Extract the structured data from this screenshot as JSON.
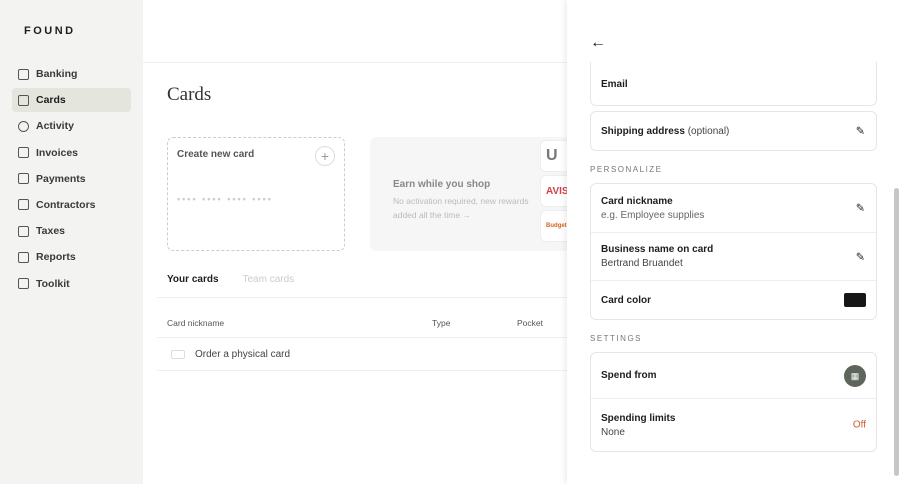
{
  "sidebar": {
    "logo": "FOUND",
    "items": [
      {
        "label": "Banking"
      },
      {
        "label": "Cards"
      },
      {
        "label": "Activity"
      },
      {
        "label": "Invoices"
      },
      {
        "label": "Payments"
      },
      {
        "label": "Contractors"
      },
      {
        "label": "Taxes"
      },
      {
        "label": "Reports"
      },
      {
        "label": "Toolkit"
      }
    ]
  },
  "main": {
    "title": "Cards",
    "create_label": "Create new card",
    "card_dots": "•••• •••• •••• ••••",
    "earn_title": "Earn while you shop",
    "earn_sub": "No activation required, new rewards added all the time →",
    "partners": [
      "U",
      "AVIS",
      "Budget"
    ],
    "tabs": [
      "Your cards",
      "Team cards"
    ],
    "columns": [
      "Card nickname",
      "Type",
      "Pocket"
    ],
    "row_label": "Order a physical card"
  },
  "drawer": {
    "email_label": "Email",
    "shipping_label": "Shipping address",
    "shipping_optional": "(optional)",
    "personalize_label": "PERSONALIZE",
    "nickname_label": "Card nickname",
    "nickname_placeholder": "e.g. Employee supplies",
    "business_label": "Business name on card",
    "business_value": "Bertrand Bruandet",
    "color_label": "Card color",
    "color_value": "#161616",
    "settings_label": "SETTINGS",
    "spend_from_label": "Spend from",
    "limits_label": "Spending limits",
    "limits_value": "None",
    "limits_status": "Off"
  }
}
